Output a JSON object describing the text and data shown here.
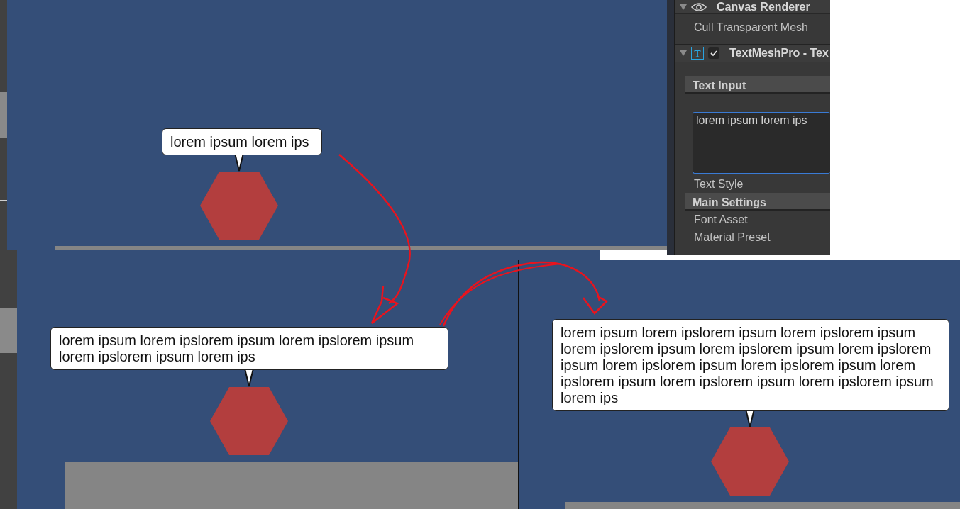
{
  "scenes": [
    {
      "bubble": "lorem ipsum lorem ips"
    },
    {
      "bubble": "lorem ipsum lorem ipslorem ipsum lorem ipslorem ipsum lorem ipslorem ipsum lorem ips"
    },
    {
      "bubble": "lorem ipsum lorem ipslorem ipsum lorem ipslorem ipsum lorem ipslorem ipsum lorem ipslorem ipsum lorem ipslorem ipsum lorem ipslorem ipsum lorem ipslorem ipsum lorem ipslorem ipsum lorem ipslorem ipsum lorem ipslorem ipsum lorem ips"
    }
  ],
  "inspector": {
    "items": [
      {
        "kind": "component",
        "title": "Canvas Renderer",
        "expanded": true
      },
      {
        "kind": "field",
        "label": "Cull Transparent Mesh"
      },
      {
        "kind": "component",
        "title": "TextMeshPro - Tex",
        "expanded": true,
        "enabled": true
      },
      {
        "kind": "section",
        "label": "Text Input"
      },
      {
        "kind": "textarea",
        "value": "lorem ipsum lorem ips"
      },
      {
        "kind": "field",
        "label": "Text Style"
      },
      {
        "kind": "section",
        "label": "Main Settings"
      },
      {
        "kind": "field",
        "label": "Font Asset"
      },
      {
        "kind": "field",
        "label": "Material Preset"
      }
    ]
  }
}
